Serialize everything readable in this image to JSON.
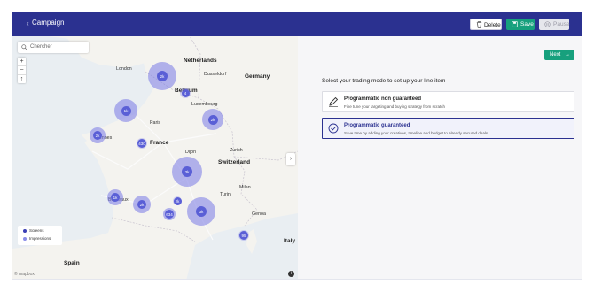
{
  "header": {
    "back_icon": "chevron-left-icon",
    "title": "Campaign",
    "delete_label": "Delete",
    "save_label": "Save",
    "pause_label": "Pause"
  },
  "map": {
    "search_placeholder": "Chercher",
    "zoom_in": "+",
    "zoom_out": "−",
    "compass": "↑",
    "expand": "›",
    "attribution": "© mapbox",
    "info": "i",
    "labels": {
      "netherlands": "Netherlands",
      "london": "London",
      "dusseldorf": "Dusseldorf",
      "germany": "Germany",
      "belgium": "Belgium",
      "luxembourg": "Luxembourg",
      "paris": "Paris",
      "rennes": "Rennes",
      "france": "France",
      "dijon": "Dijon",
      "zurich": "Zurich",
      "switzerland": "Switzerland",
      "bordeaux": "Bordeaux",
      "turin": "Turin",
      "milan": "Milan",
      "genoa": "Genoa",
      "italy": "Italy",
      "spain": "Spain"
    },
    "clusters": [
      "2k",
      "4",
      "1k",
      "2k",
      "2k",
      "430",
      "3k",
      "1k",
      "2k",
      "2k",
      "634",
      "3k",
      "95"
    ],
    "legend": {
      "screens": "Screens",
      "impressions": "Impressions",
      "screens_color": "#3b3fb5",
      "impressions_color": "#8a8de8"
    }
  },
  "panel": {
    "next_label": "Next",
    "next_arrow": "→",
    "prompt": "Select your trading mode to set up your line item",
    "options": [
      {
        "title": "Programmatic non guaranteed",
        "desc": "Fine tune your targeting and buying strategy from scratch",
        "icon": "pencil-icon",
        "selected": false
      },
      {
        "title": "Programmatic guaranteed",
        "desc": "Save time by adding your creatives, timeline and budget to already secured deals.",
        "icon": "check-circle-icon",
        "selected": true
      }
    ]
  },
  "colors": {
    "header": "#2b3190",
    "accent": "#17a07d",
    "cluster": "#5a5fd6"
  }
}
